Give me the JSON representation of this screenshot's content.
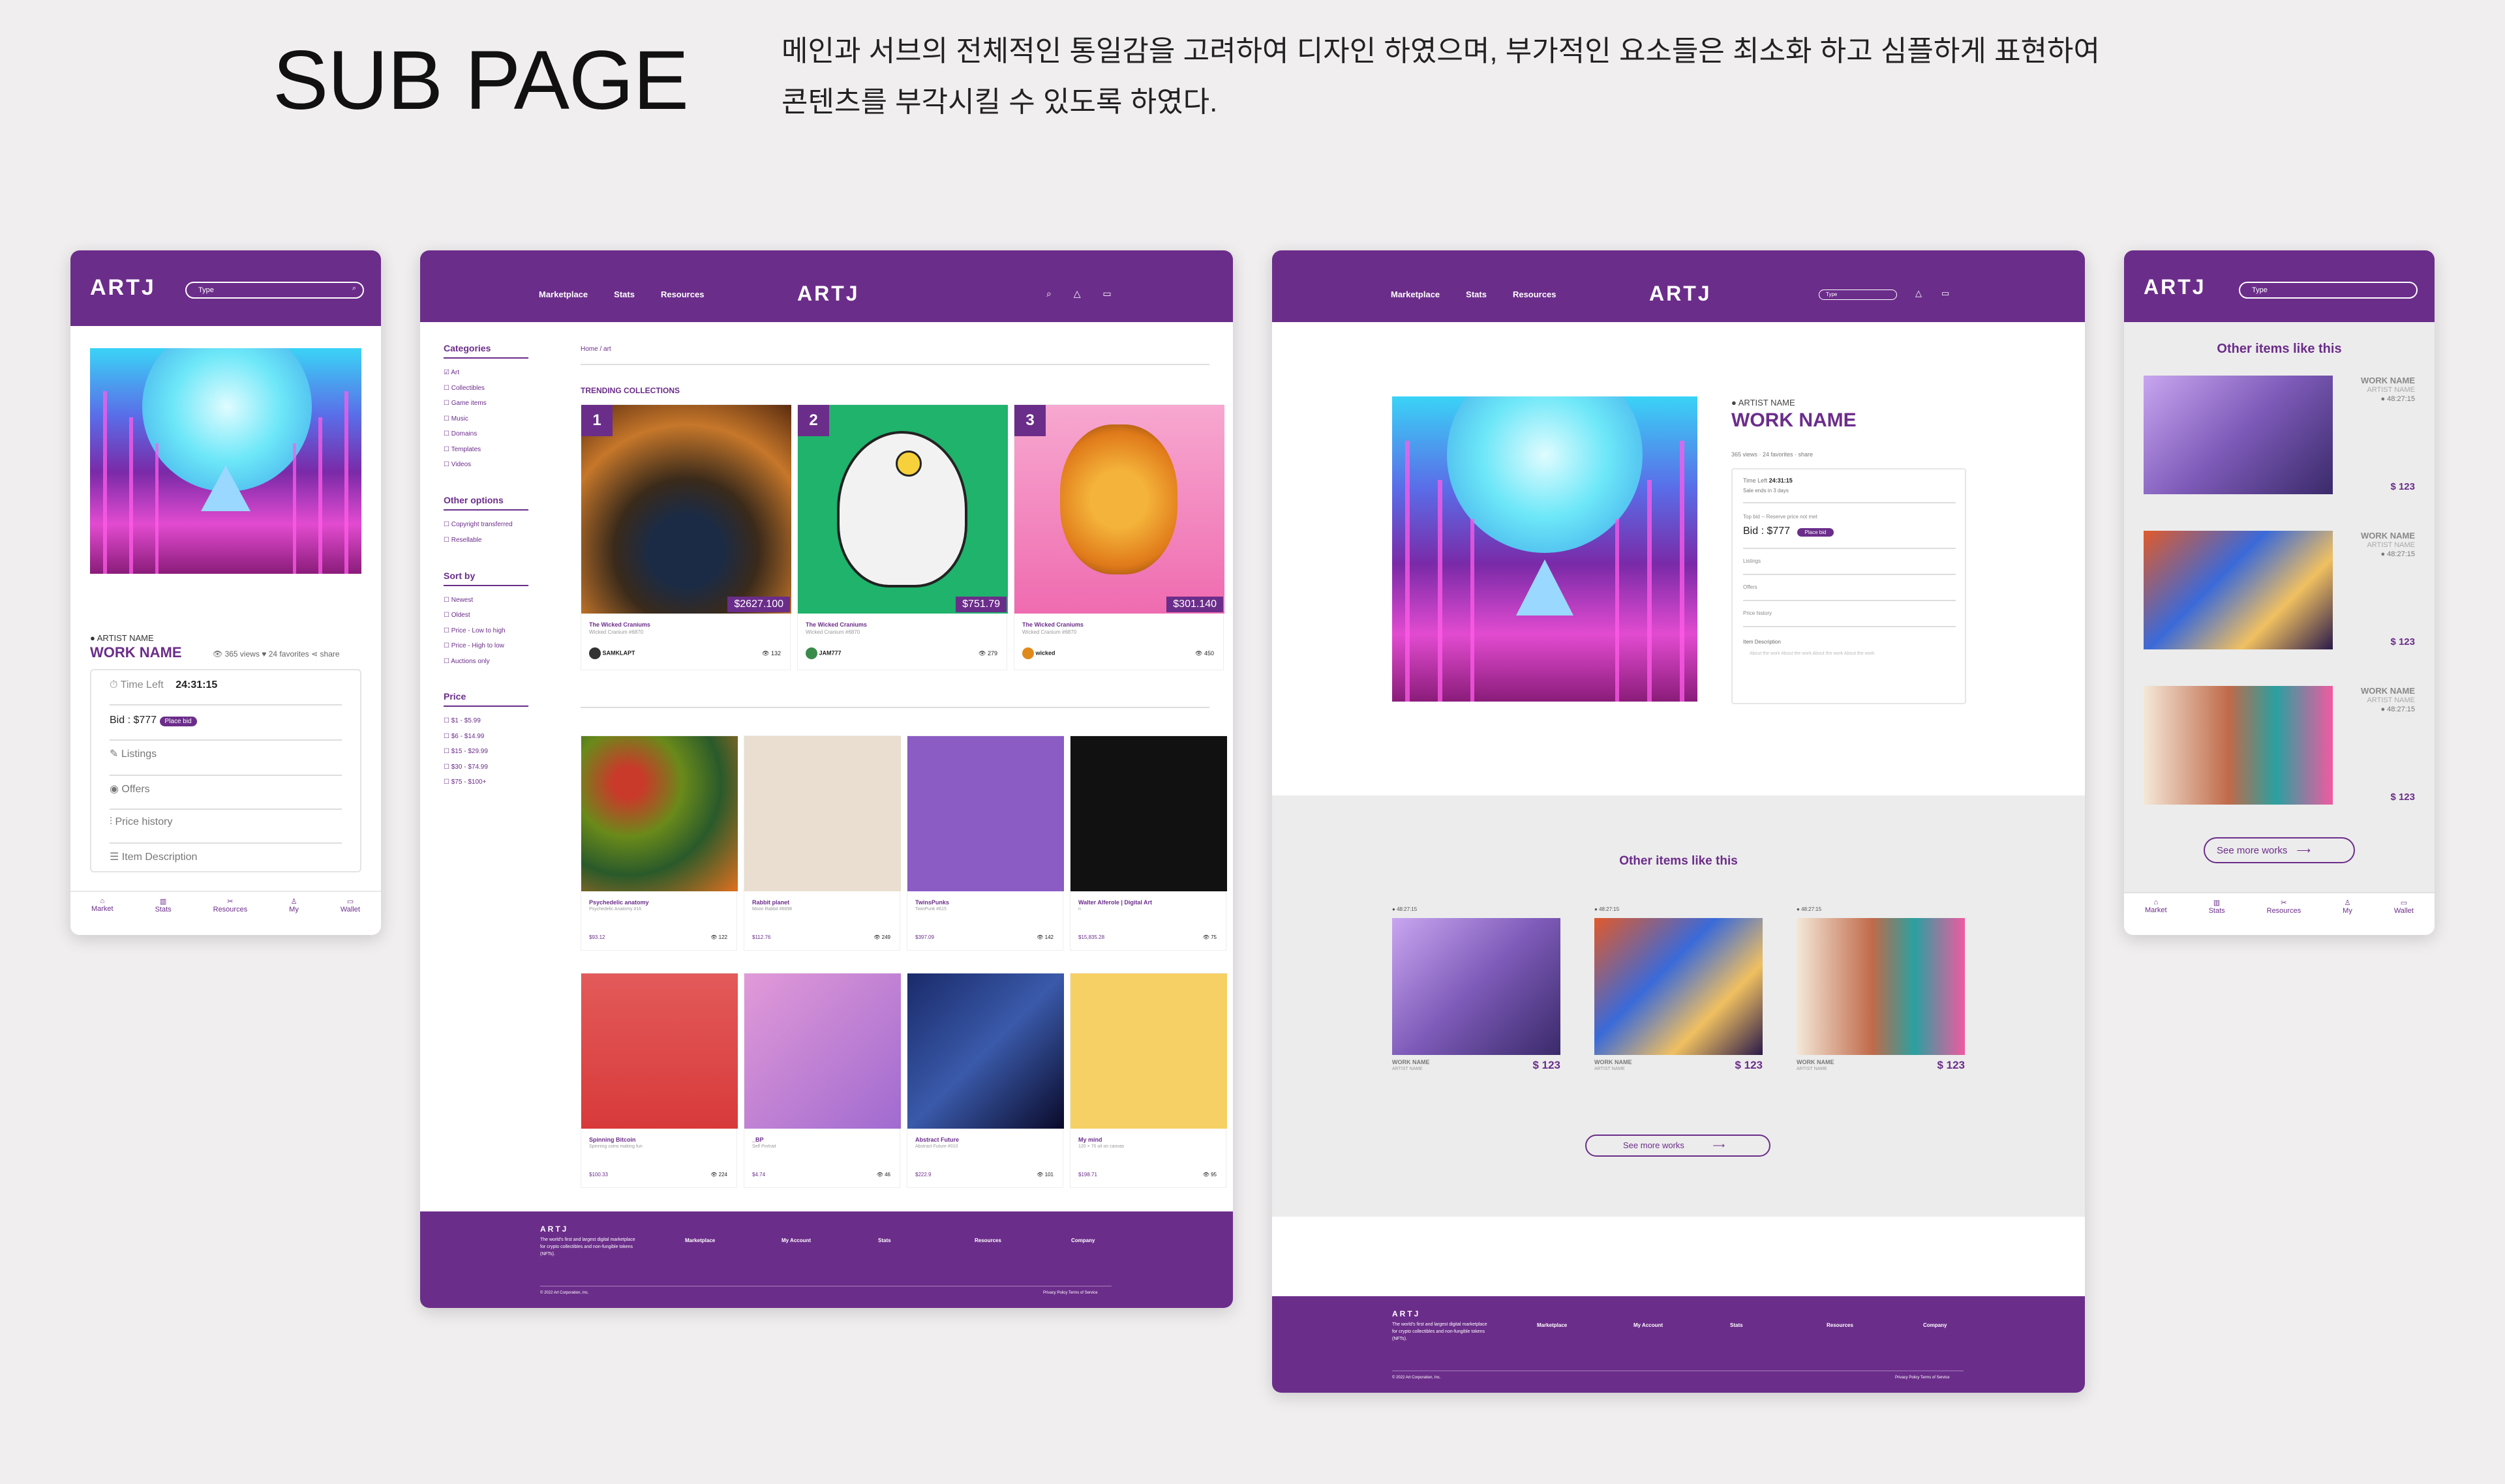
{
  "header": {
    "title": "SUB PAGE",
    "desc_line1": "메인과 서브의 전체적인 통일감을 고려하여 디자인 하였으며, 부가적인 요소들은 최소화 하고 심플하게 표현하여",
    "desc_line2": "콘텐츠를  부각시킬 수 있도록 하였다."
  },
  "brand": "ARTJ",
  "search_placeholder": "Type",
  "mobile1": {
    "artist": "ARTIST NAME",
    "work": "WORK NAME",
    "views": "365 views",
    "favorites": "24 favorites",
    "share": "share",
    "time_label": "Time Left",
    "time_value": "24:31:15",
    "bid": "Bid : $777",
    "place_bid": "Place bid",
    "rows": [
      "Listings",
      "Offers",
      "Price history",
      "Item Description"
    ]
  },
  "tabbar": [
    "Market",
    "Stats",
    "Resources",
    "My",
    "Wallet"
  ],
  "desktop": {
    "nav": [
      "Marketplace",
      "Stats",
      "Resources"
    ],
    "sidebar": {
      "categories_title": "Categories",
      "categories": [
        "Art",
        "Collectibles",
        "Game items",
        "Music",
        "Domains",
        "Templates",
        "Videos"
      ],
      "other_title": "Other options",
      "other": [
        "Copyright transferred",
        "Resellable"
      ],
      "sort_title": "Sort by",
      "sort": [
        "Newest",
        "Oldest",
        "Price - Low to high",
        "Price - High to low",
        "Auctions only"
      ],
      "price_title": "Price",
      "price": [
        "$1 - $5.99",
        "$6 - $14.99",
        "$15 - $29.99",
        "$30 - $74.99",
        "$75 - $100+"
      ]
    },
    "breadcrumb": "Home / art",
    "trending_title": "TRENDING COLLECTIONS",
    "trending": [
      {
        "rank": "1",
        "price": "$2627.100",
        "name": "The Wicked Craniums",
        "sub": "Wicked Cranium #6870",
        "user": "SAMKLAPT",
        "views": "132"
      },
      {
        "rank": "2",
        "price": "$751.79",
        "name": "The Wicked Craniums",
        "sub": "Wicked Cranium #6870",
        "user": "JAM777",
        "views": "279"
      },
      {
        "rank": "3",
        "price": "$301.140",
        "name": "The Wicked Craniums",
        "sub": "Wicked Cranium #6870",
        "user": "wicked",
        "views": "450"
      }
    ],
    "grid": [
      {
        "name": "Psychedelic anatomy",
        "sub": "Psychedelic Anatomy #16",
        "price": "$93.12",
        "views": "122"
      },
      {
        "name": "Rabbit planet",
        "sub": "Moon Rabbit #6898",
        "price": "$112.76",
        "views": "249"
      },
      {
        "name": "TwinsPunks",
        "sub": "TwinPunk #615",
        "price": "$397.09",
        "views": "142"
      },
      {
        "name": "Walter Alferole | Digital Art",
        "sub": "n",
        "price": "$15,835.28",
        "views": "75"
      },
      {
        "name": "Spinning Bitcoin",
        "sub": "Spinning coins making fun",
        "price": "$100.33",
        "views": "224"
      },
      {
        "name": "_BP",
        "sub": "Self Portrait",
        "price": "$4.74",
        "views": "46"
      },
      {
        "name": "Abstract Future",
        "sub": "Abstract Future #010",
        "price": "$222.9",
        "views": "101"
      },
      {
        "name": "My mind",
        "sub": "120 × 70 oil on canvas",
        "price": "$198.71",
        "views": "95"
      }
    ]
  },
  "detail": {
    "artist": "ARTIST NAME",
    "work": "WORK NAME",
    "meta": "365 views · 24 favorites · share",
    "time_label": "Time Left",
    "time_value": "24:31:15",
    "sale_ends": "Sale ends in 3 days",
    "topbid": "Top bid -- Reserve price not met",
    "bid": "Bid : $777",
    "place_bid": "Place bid",
    "rows": [
      "Listings",
      "Offers",
      "Price history"
    ],
    "desc_title": "Item Description",
    "desc": "About the work About the work About the work About the work",
    "other_title": "Other items like this",
    "items": [
      {
        "time": "48:27:15",
        "work": "WORK NAME",
        "artist": "ARTIST NAME",
        "price": "$ 123"
      },
      {
        "time": "48:27:15",
        "work": "WORK NAME",
        "artist": "ARTIST NAME",
        "price": "$ 123"
      },
      {
        "time": "48:27:15",
        "work": "WORK NAME",
        "artist": "ARTIST NAME",
        "price": "$ 123"
      }
    ],
    "see_more": "See more works"
  },
  "mobile2": {
    "title": "Other items like this",
    "items": [
      {
        "work": "WORK NAME",
        "artist": "ARTIST NAME",
        "time": "48:27:15",
        "price": "$ 123"
      },
      {
        "work": "WORK NAME",
        "artist": "ARTIST NAME",
        "time": "48:27:15",
        "price": "$ 123"
      },
      {
        "work": "WORK NAME",
        "artist": "ARTIST NAME",
        "time": "48:27:15",
        "price": "$ 123"
      }
    ],
    "see_more": "See more works"
  },
  "footer": {
    "brand": "ARTJ",
    "about": "The world's first and largest digital marketplace for crypto collectibles and non-fungible tokens (NFTs).",
    "cols": [
      "Marketplace",
      "My Account",
      "Stats",
      "Resources",
      "Company"
    ],
    "copyright": "© 2022 Art Corporation, Inc.",
    "links": "Privacy Policy   Terms of Service"
  }
}
